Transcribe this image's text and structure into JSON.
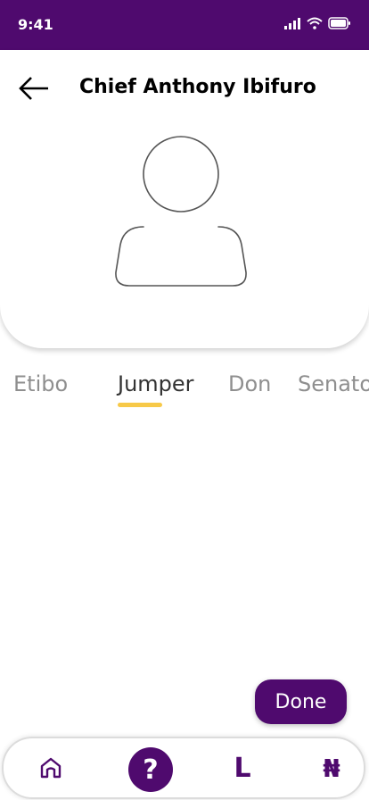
{
  "status_bar": {
    "time": "9:41"
  },
  "header": {
    "title": "Chief Anthony Ibifuro"
  },
  "tabs": [
    {
      "label": "Etibo",
      "active": false
    },
    {
      "label": "Jumper",
      "active": true
    },
    {
      "label": "Don",
      "active": false
    },
    {
      "label": "Senato",
      "active": false
    }
  ],
  "actions": {
    "done_label": "Done"
  },
  "bottom_nav": {
    "help_glyph": "?",
    "l_glyph": "L",
    "currency_glyph": "₦"
  },
  "colors": {
    "primary": "#4f0a6e",
    "accent": "#f7c948"
  }
}
